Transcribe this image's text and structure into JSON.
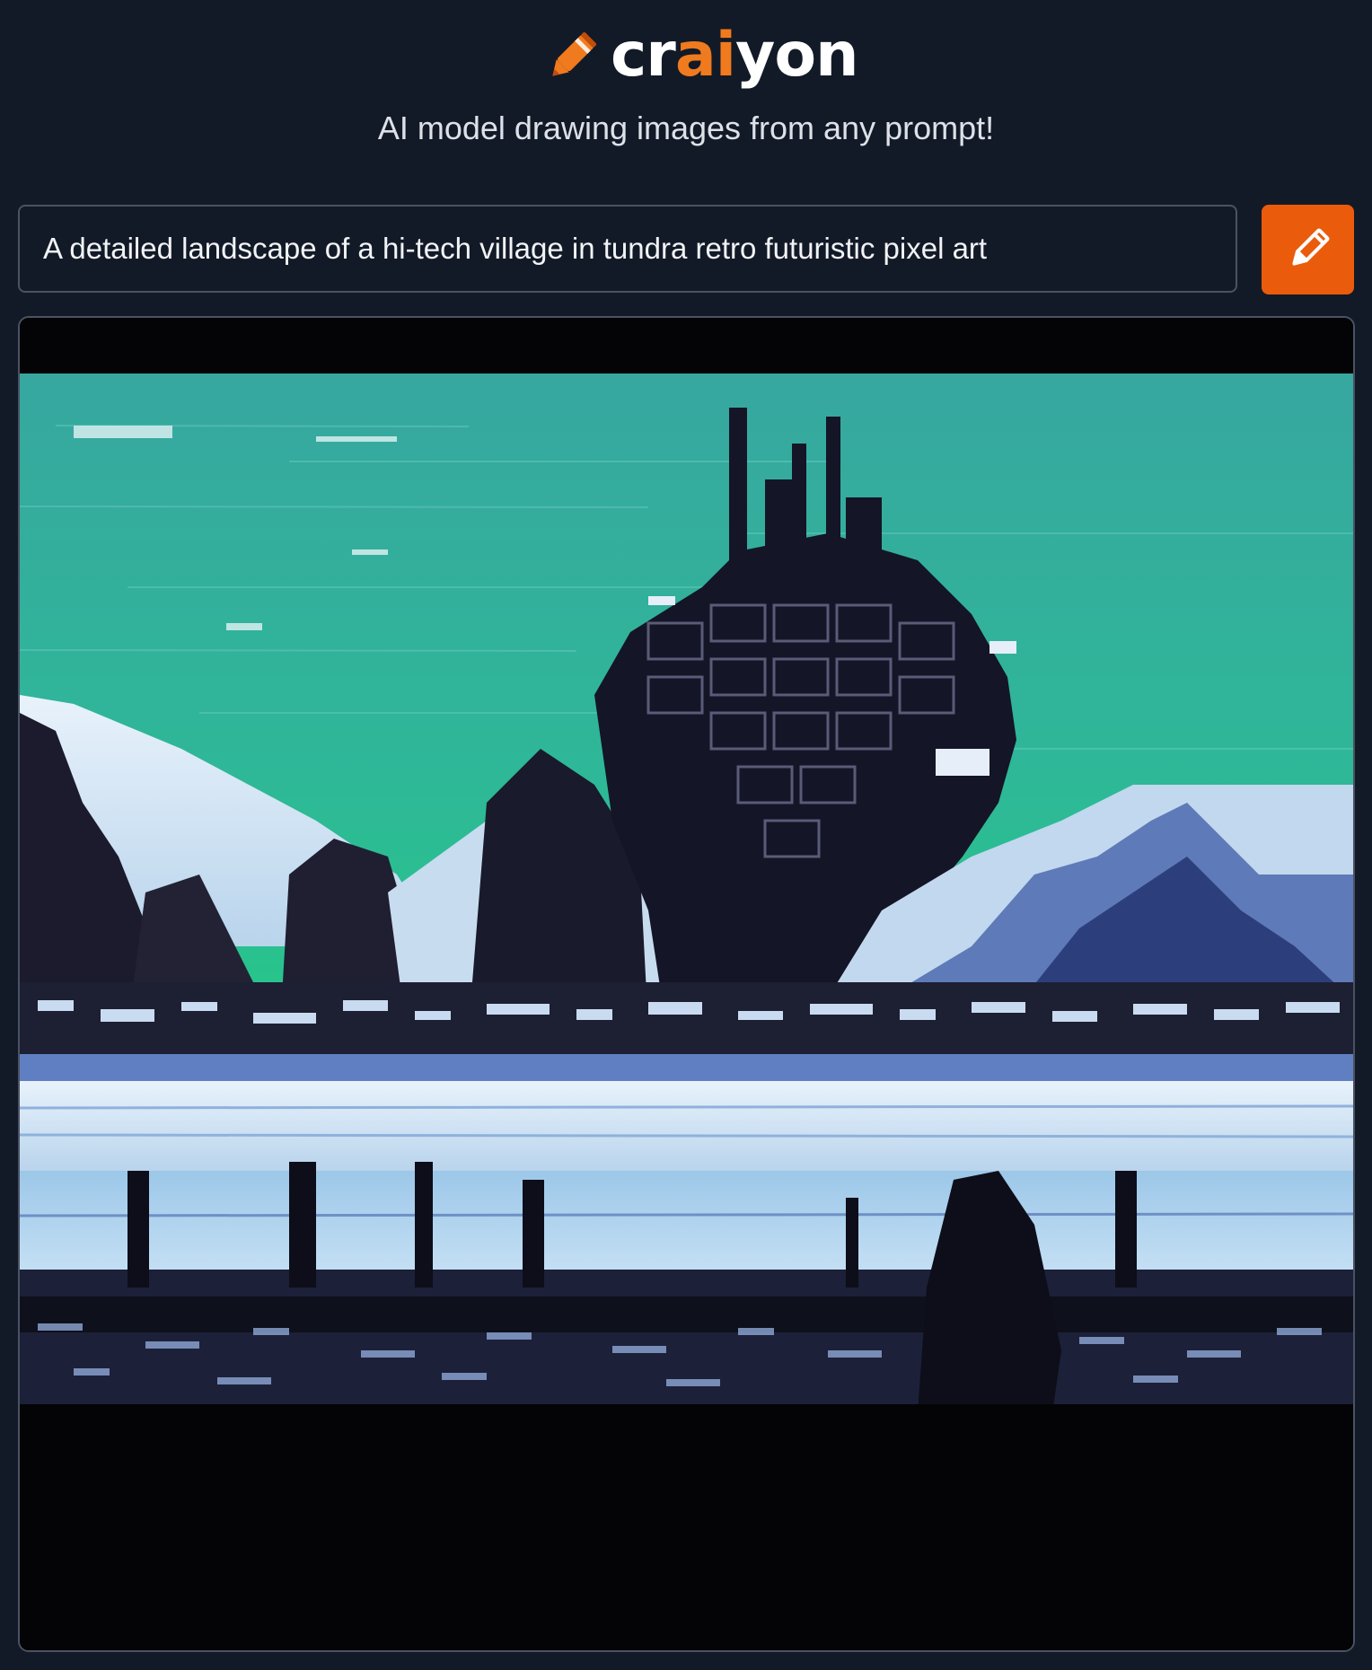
{
  "brand": {
    "name_prefix": "cr",
    "name_accent": "ai",
    "name_suffix": "yon",
    "accent_color": "#f07a1e",
    "logo_icon": "crayon-icon"
  },
  "tagline": "AI model drawing images from any prompt!",
  "prompt": {
    "value": "A detailed landscape of a hi-tech village in tundra retro futuristic pixel art"
  },
  "draw_button": {
    "icon": "pencil-icon",
    "color": "#ea5b0c"
  },
  "result": {
    "image": "generated-image"
  },
  "colors": {
    "background": "#131a27",
    "border": "#4a5263"
  }
}
